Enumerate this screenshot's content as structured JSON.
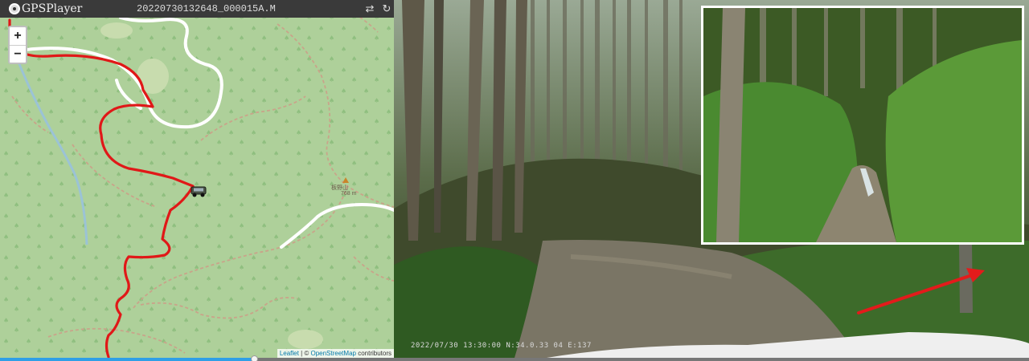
{
  "app": {
    "name": "GPSPlayer",
    "file_name": "20220730132648_000015A.M"
  },
  "toolbar": {
    "swap_icon": "swap-arrows-icon",
    "reload_icon": "reload-icon"
  },
  "map": {
    "zoom_in_label": "+",
    "zoom_out_label": "−",
    "peak_name": "板野山",
    "peak_elevation": "768 m",
    "attribution": {
      "leaflet": "Leaflet",
      "separator": " | © ",
      "osm": "OpenStreetMap",
      "suffix": " contributors"
    },
    "colors": {
      "background": "#aed09a",
      "track": "#e01818",
      "road": "#ffffff",
      "trail": "#c9a48a",
      "stream": "#9bc3d6"
    },
    "marker_icon": "car-icon"
  },
  "video": {
    "osd_text": "2022/07/30 13:30:00 N:34.0.33 04 E:137",
    "arrow_color": "#e31b1b",
    "inset_border_color": "#ffffff"
  },
  "timeline": {
    "progress": 0.247,
    "colors": {
      "played": "#2f9fe6",
      "remaining": "#777777"
    }
  }
}
